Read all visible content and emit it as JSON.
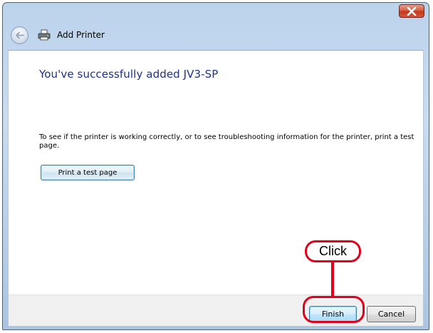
{
  "window": {
    "title": "Add Printer",
    "icons": {
      "close": "close-icon",
      "back": "back-arrow-icon",
      "app": "printer-icon"
    }
  },
  "content": {
    "heading": "You've successfully added JV3-SP",
    "description": "To see if the printer is working correctly, or to see troubleshooting information for the printer, print a test page.",
    "test_button_label": "Print a test page"
  },
  "footer": {
    "finish_label": "Finish",
    "cancel_label": "Cancel"
  },
  "annotation": {
    "label": "Click",
    "color": "#e2001a"
  },
  "colors": {
    "heading": "#1e3287",
    "close_button": "#c2371a",
    "frame": "#bcd3ec"
  }
}
